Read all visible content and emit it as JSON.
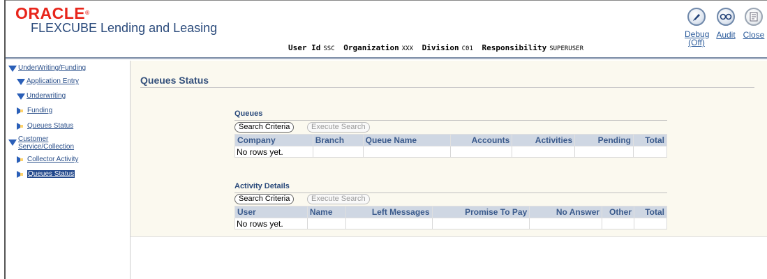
{
  "header": {
    "brand": "ORACLE",
    "brand_mark": "®",
    "product": "FLEXCUBE Lending and Leasing",
    "user_id_label": "User Id",
    "user_id": "SSC",
    "organization_label": "Organization",
    "organization": "XXX",
    "division_label": "Division",
    "division": "C01",
    "responsibility_label": "Responsibility",
    "responsibility": "SUPERUSER",
    "global_buttons": {
      "debug_label": "Debug",
      "debug_state": "(Off)",
      "audit_label": "Audit",
      "close_label": "Close"
    }
  },
  "sidebar": {
    "items": [
      {
        "label": "UnderWriting/Funding",
        "state": "expanded"
      },
      {
        "label": "Application Entry",
        "state": "expanded"
      },
      {
        "label": "Underwriting",
        "state": "expanded"
      },
      {
        "label": "Funding",
        "state": "collapsed"
      },
      {
        "label": "Queues Status",
        "state": "collapsed"
      },
      {
        "label": "Customer",
        "label2": "Service/Collection",
        "state": "expanded"
      },
      {
        "label": "Collector Activity",
        "state": "collapsed"
      },
      {
        "label": "Queues Status",
        "state": "collapsed",
        "selected": true
      }
    ]
  },
  "main": {
    "page_title": "Queues Status",
    "queues": {
      "title": "Queues",
      "search_button": "Search Criteria",
      "execute_button": "Execute Search",
      "columns": [
        "Company",
        "Branch",
        "Queue Name",
        "Accounts",
        "Activities",
        "Pending",
        "Total"
      ],
      "empty_text": "No rows yet."
    },
    "activity": {
      "title": "Activity Details",
      "search_button": "Search Criteria",
      "execute_button": "Execute Search",
      "columns": [
        "User",
        "Name",
        "Left Messages",
        "Promise To Pay",
        "No Answer",
        "Other",
        "Total"
      ],
      "empty_text": "No rows yet."
    }
  },
  "colors": {
    "oracle_red": "#e8251b",
    "header_blue": "#2a4a7b",
    "table_header_bg": "#cfd7e3",
    "content_bg": "#fbf9ef",
    "selected_nav_bg": "#20468a"
  }
}
